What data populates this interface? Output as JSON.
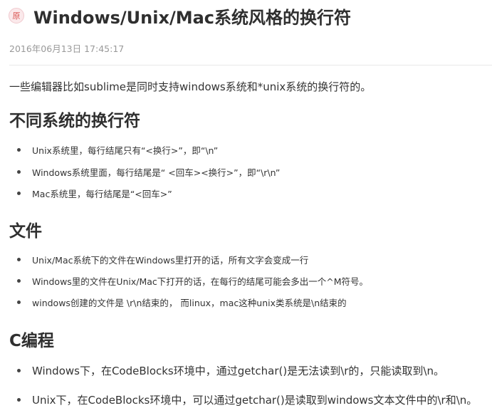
{
  "header": {
    "badge": "原",
    "title": "Windows/Unix/Mac系统风格的换行符"
  },
  "meta": {
    "date": "2016年06月13日 17:45:17"
  },
  "intro": "一些编辑器比如sublime是同时支持windows系统和*unix系统的换行符的。",
  "sections": [
    {
      "heading": "不同系统的换行符",
      "items": [
        "Unix系统里，每行结尾只有“<换行>”，即“\\n”",
        "Windows系统里面，每行结尾是“ <回车><换行>”，即“\\r\\n”",
        "Mac系统里，每行结尾是“<回车>”"
      ]
    },
    {
      "heading": "文件",
      "items": [
        "Unix/Mac系统下的文件在Windows里打开的话，所有文字会变成一行",
        "Windows里的文件在Unix/Mac下打开的话，在每行的结尾可能会多出一个^M符号。",
        "windows创建的文件是 \\r\\n结束的， 而linux，mac这种unix类系统是\\n结束的"
      ]
    },
    {
      "heading": "C编程",
      "items": [
        "Windows下，在CodeBlocks环境中，通过getchar()是无法读到\\r的，只能读取到\\n。",
        "Unix下，在CodeBlocks环境中，可以通过getchar()是读取到windows文本文件中的\\r和\\n。"
      ]
    }
  ]
}
